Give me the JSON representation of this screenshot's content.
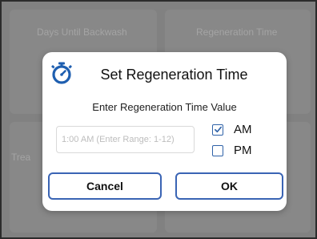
{
  "background": {
    "tile_top_left_label": "Days Until Backwash",
    "tile_top_right_label": "Regeneration Time",
    "tile_mid_left_label": "Trea"
  },
  "dialog": {
    "title": "Set Regeneration Time",
    "icon": "stopwatch-icon",
    "prompt": "Enter Regeneration Time Value",
    "input_value": "",
    "input_placeholder": "1:00 AM (Enter Range: 1-12)",
    "am_label": "AM",
    "am_checked": true,
    "pm_label": "PM",
    "pm_checked": false,
    "cancel_label": "Cancel",
    "ok_label": "OK"
  },
  "colors": {
    "accent": "#2f62a8",
    "button_border": "#3a64b4",
    "icon": "#1f5fb0"
  }
}
